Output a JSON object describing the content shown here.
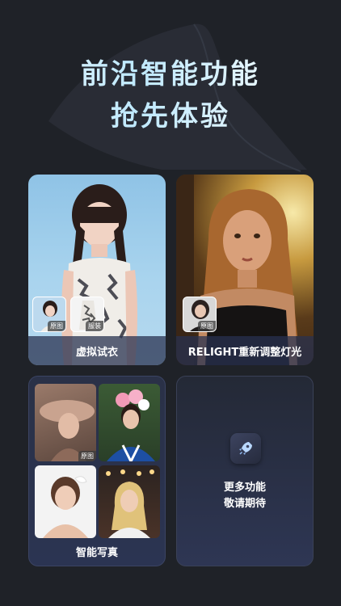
{
  "hero": {
    "line1": "前沿智能功能",
    "line2": "抢先体验"
  },
  "cards": {
    "try_on": {
      "label": "虚拟试衣",
      "thumb_original": "原图",
      "thumb_outfit": "服装"
    },
    "relight": {
      "label": "RELIGHT重新调整灯光",
      "thumb_original": "原图"
    },
    "portrait": {
      "label": "智能写真",
      "thumb_original": "原图"
    },
    "coming_soon": {
      "line1": "更多功能",
      "line2": "敬请期待",
      "icon": "rocket-icon"
    }
  },
  "colors": {
    "background": "#1f2228",
    "label_bar": "#28325099",
    "accent": "#bfe9ff"
  }
}
